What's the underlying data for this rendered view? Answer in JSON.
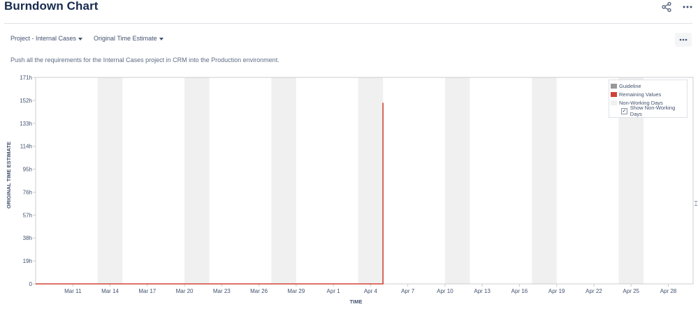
{
  "page": {
    "title": "Burndown Chart",
    "description": "Push all the requirements for the Internal Cases project in CRM into the Production environment."
  },
  "header": {
    "share_icon": "share-icon",
    "more_icon": "more-horizontal-icon"
  },
  "filters": {
    "project_label": "Project - Internal Cases",
    "estimate_label": "Original Time Estimate"
  },
  "chart_data": {
    "type": "line",
    "xlabel": "TIME",
    "ylabel": "ORIGINAL TIME ESTIMATE",
    "y_unit": "h",
    "ylim": [
      0,
      171
    ],
    "y_ticks": [
      0,
      19,
      38,
      57,
      76,
      95,
      114,
      133,
      152,
      171
    ],
    "y_tick_labels": [
      "0",
      "19h",
      "38h",
      "57h",
      "76h",
      "95h",
      "114h",
      "133h",
      "152h",
      "171h"
    ],
    "x_range": [
      "Mar 8",
      "Apr 30"
    ],
    "x_ticks": [
      "Mar 11",
      "Mar 14",
      "Mar 17",
      "Mar 20",
      "Mar 23",
      "Mar 26",
      "Mar 29",
      "Apr 1",
      "Apr 4",
      "Apr 7",
      "Apr 10",
      "Apr 13",
      "Apr 16",
      "Apr 19",
      "Apr 22",
      "Apr 25",
      "Apr 28"
    ],
    "non_working_days": [
      [
        "Mar 13",
        "Mar 15"
      ],
      [
        "Mar 20",
        "Mar 22"
      ],
      [
        "Mar 27",
        "Mar 29"
      ],
      [
        "Apr 3",
        "Apr 5"
      ],
      [
        "Apr 10",
        "Apr 12"
      ],
      [
        "Apr 17",
        "Apr 19"
      ],
      [
        "Apr 24",
        "Apr 26"
      ]
    ],
    "series": [
      {
        "name": "Remaining Values",
        "color": "#d04437",
        "points": [
          {
            "x": "Mar 8",
            "y": 0
          },
          {
            "x": "Apr 5",
            "y": 0
          },
          {
            "x": "Apr 5",
            "y": 150
          },
          {
            "x": "Apr 5",
            "y": 0
          }
        ]
      }
    ],
    "legend": {
      "placement": "top-right",
      "entries": [
        {
          "label": "Guideline",
          "color": "#999999"
        },
        {
          "label": "Remaining Values",
          "color": "#d04437"
        },
        {
          "label": "Non-Working Days",
          "color": "#f0f0f0"
        }
      ],
      "show_non_working_label": "Show Non-Working Days",
      "show_non_working_checked": true
    },
    "grid": false
  }
}
